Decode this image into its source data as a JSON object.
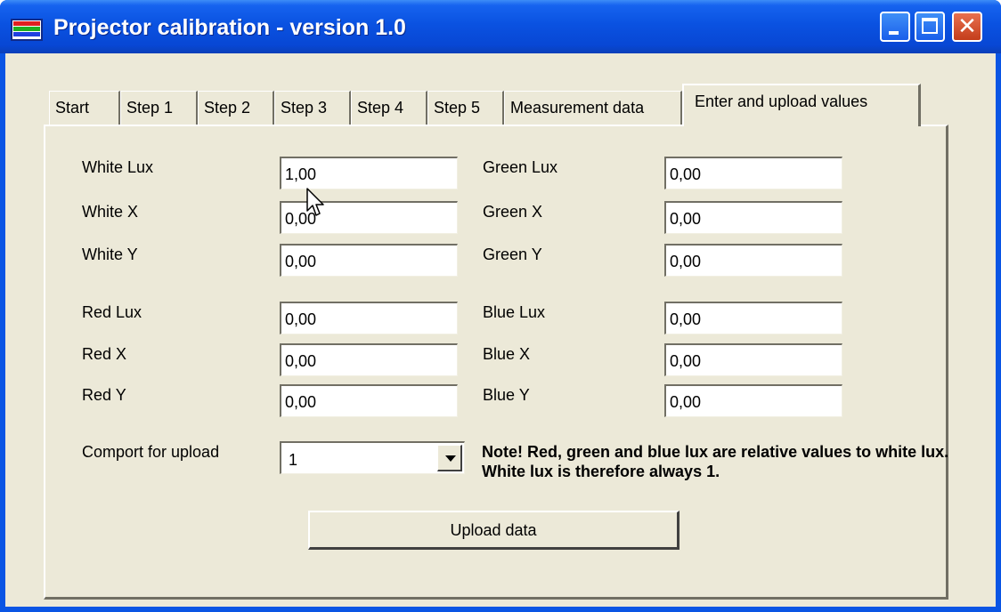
{
  "window": {
    "title": "Projector calibration - version 1.0",
    "icon": "rgb-bars-icon",
    "controls": {
      "minimize": "minimize-icon",
      "maximize": "maximize-icon",
      "close": "✕"
    }
  },
  "tabs": [
    {
      "label": "Start"
    },
    {
      "label": "Step 1"
    },
    {
      "label": "Step 2"
    },
    {
      "label": "Step 3"
    },
    {
      "label": "Step 4"
    },
    {
      "label": "Step 5"
    },
    {
      "label": "Measurement data"
    },
    {
      "label": "Enter and upload values"
    }
  ],
  "active_tab": "Enter and upload values",
  "fields": {
    "white_lux": {
      "label": "White Lux",
      "value": "1,00"
    },
    "white_x": {
      "label": "White X",
      "value": "0,00"
    },
    "white_y": {
      "label": "White Y",
      "value": "0,00"
    },
    "red_lux": {
      "label": "Red Lux",
      "value": "0,00"
    },
    "red_x": {
      "label": "Red X",
      "value": "0,00"
    },
    "red_y": {
      "label": "Red Y",
      "value": "0,00"
    },
    "green_lux": {
      "label": "Green Lux",
      "value": "0,00"
    },
    "green_x": {
      "label": "Green X",
      "value": "0,00"
    },
    "green_y": {
      "label": "Green Y",
      "value": "0,00"
    },
    "blue_lux": {
      "label": "Blue Lux",
      "value": "0,00"
    },
    "blue_x": {
      "label": "Blue X",
      "value": "0,00"
    },
    "blue_y": {
      "label": "Blue Y",
      "value": "0,00"
    }
  },
  "comport": {
    "label": "Comport for upload",
    "value": "1"
  },
  "note": "Note! Red, green and blue lux are relative values to white lux. White lux is therefore always 1.",
  "upload_button": "Upload data",
  "colors": {
    "titlebar": "#0a52e1",
    "face": "#ece9d8",
    "close": "#d9532f"
  }
}
